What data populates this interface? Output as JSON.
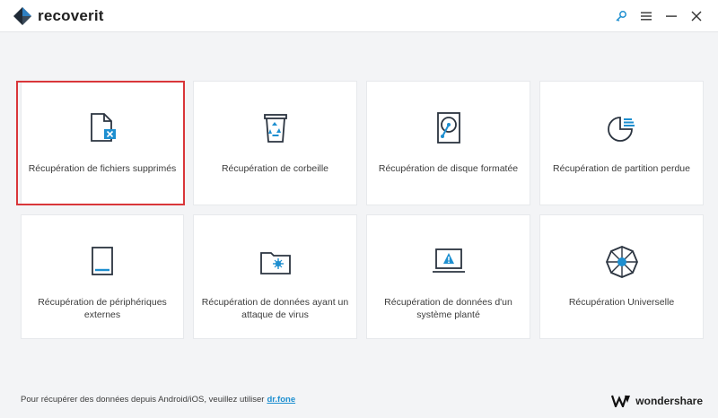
{
  "app": {
    "title": "recoverit"
  },
  "titlebar": {
    "icons": [
      "key-icon",
      "menu-icon",
      "minimize-icon",
      "close-icon"
    ]
  },
  "cards": [
    {
      "label": "Récupération de fichiers supprimés",
      "icon": "deleted-file-icon",
      "selected": true
    },
    {
      "label": "Récupération de corbeille",
      "icon": "recycle-bin-icon",
      "selected": false
    },
    {
      "label": "Récupération de disque formatée",
      "icon": "hard-disk-icon",
      "selected": false
    },
    {
      "label": "Récupération de partition perdue",
      "icon": "partition-icon",
      "selected": false
    },
    {
      "label": "Récupération de périphériques externes",
      "icon": "external-device-icon",
      "selected": false
    },
    {
      "label": "Récupération de données ayant un attaque de virus",
      "icon": "virus-folder-icon",
      "selected": false
    },
    {
      "label": "Récupération de données d'un système planté",
      "icon": "crashed-system-icon",
      "selected": false
    },
    {
      "label": "Récupération Universelle",
      "icon": "universal-recovery-icon",
      "selected": false
    }
  ],
  "footer": {
    "note": "Pour récupérer des données depuis Android/iOS, veuillez utiliser",
    "link": "dr.fone",
    "brand": "wondershare"
  },
  "colors": {
    "accent": "#1e8fd0",
    "selection": "#d9363a",
    "icon": "#2b3440"
  }
}
